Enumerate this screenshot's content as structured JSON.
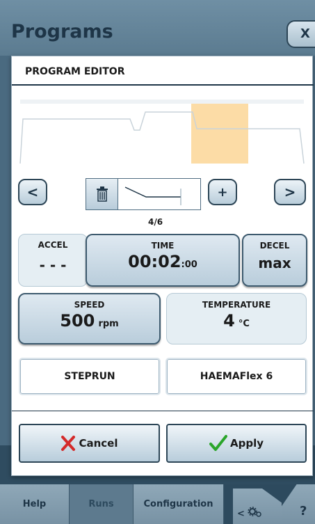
{
  "header": {
    "title": "Programs",
    "close_label": "X"
  },
  "dialog": {
    "title": "PROGRAM EDITOR",
    "step_counter": "4/6",
    "accel": {
      "label": "ACCEL",
      "value": "- - -"
    },
    "time": {
      "label": "TIME",
      "value_main": "00:02",
      "value_secs": ":00"
    },
    "decel": {
      "label": "DECEL",
      "value": "max"
    },
    "speed": {
      "label": "SPEED",
      "value": "500",
      "unit": "rpm"
    },
    "temperature": {
      "label": "TEMPERATURE",
      "value": "4",
      "unit": "°C"
    },
    "mode": "STEPRUN",
    "rotor": "HAEMAFlex 6",
    "cancel_label": "Cancel",
    "apply_label": "Apply",
    "prev_label": "<",
    "next_label": ">",
    "add_label": "+"
  },
  "nav": {
    "tabs": [
      "Help",
      "Runs",
      "Configuration"
    ],
    "help_label": "?",
    "gear_label": "<"
  },
  "colors": {
    "accent_selected_step": "#fcdca6",
    "cancel_x": "#d42a2a",
    "apply_check": "#2aa52a"
  }
}
